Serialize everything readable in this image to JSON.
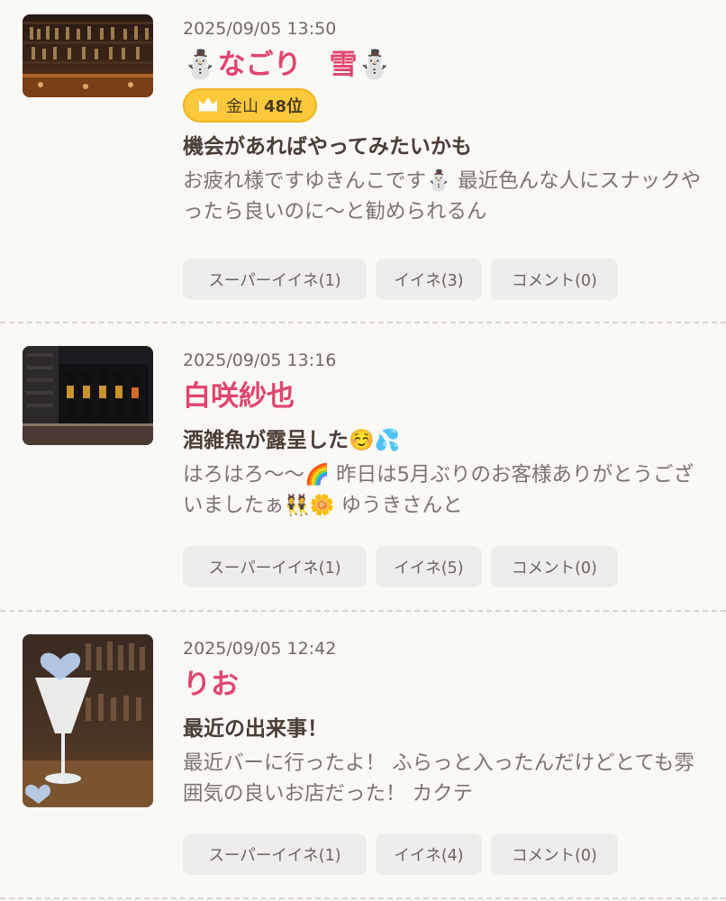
{
  "posts": [
    {
      "timestamp": "2025/09/05 13:50",
      "author": "⛄なごり　雪⛄",
      "badge": {
        "store": "金山",
        "rank": "48位"
      },
      "title": "機会があればやってみたいかも",
      "excerpt": "お疲れ様ですゆきんこです⛄ 最近色んな人にスナックやったら良いのに〜と勧められるん",
      "actions": {
        "super_like": "スーパーイイネ(1)",
        "like": "イイネ(3)",
        "comment": "コメント(0)"
      }
    },
    {
      "timestamp": "2025/09/05 13:16",
      "author": "白咲紗也",
      "title": "酒雑魚が露呈した☺️💦",
      "excerpt": "はろはろ〜〜🌈 昨日は5月ぶりのお客様ありがとうございましたぁ👯🌼 ゆうきさんと",
      "actions": {
        "super_like": "スーパーイイネ(1)",
        "like": "イイネ(5)",
        "comment": "コメント(0)"
      }
    },
    {
      "timestamp": "2025/09/05 12:42",
      "author": "りお",
      "title": "最近の出来事！",
      "excerpt": "最近バーに行ったよ！ ふらっと入ったんだけどとても雰囲気の良いお店だった！ カクテ",
      "actions": {
        "super_like": "スーパーイイネ(1)",
        "like": "イイネ(4)",
        "comment": "コメント(0)"
      }
    }
  ],
  "colors": {
    "accent": "#e0466d",
    "badge_bg": "#fbc93b",
    "button_bg": "#eeedec",
    "page_bg": "#fbf9f6"
  },
  "icons": {
    "badge_icon": "crown-icon"
  }
}
